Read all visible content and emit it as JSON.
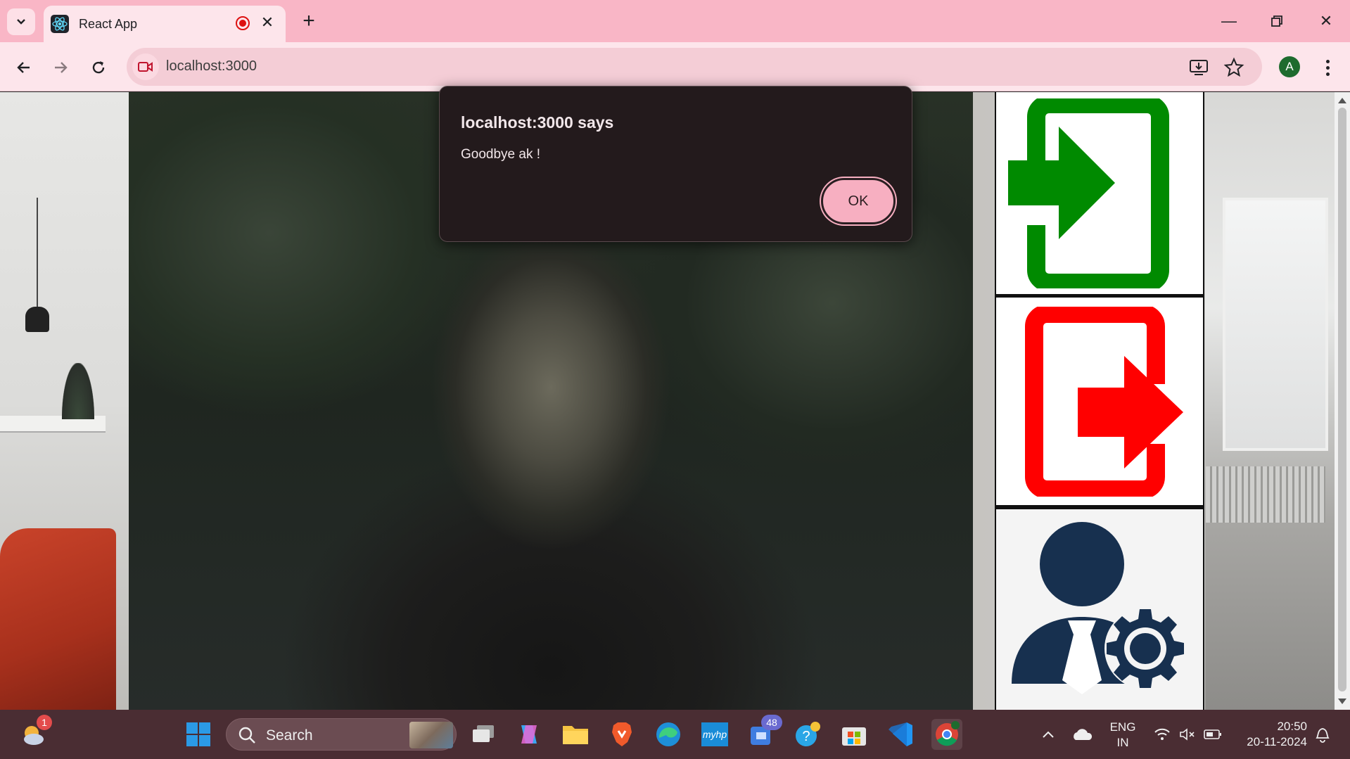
{
  "browser": {
    "tab_title": "React App",
    "url": "localhost:3000",
    "profile_initial": "A",
    "icons": [
      "tab-list-icon",
      "react-logo-icon",
      "recording-icon",
      "close-tab-icon",
      "new-tab-icon",
      "minimize-icon",
      "restore-icon",
      "close-window-icon",
      "back-icon",
      "forward-icon",
      "reload-icon",
      "camera-in-use-icon",
      "install-app-icon",
      "bookmark-star-icon",
      "chrome-menu-icon"
    ],
    "theme_color": "#f9b6c6"
  },
  "page": {
    "actions": [
      {
        "name": "check-in",
        "icon": "enter-door-icon",
        "color": "#008a00"
      },
      {
        "name": "check-out",
        "icon": "exit-door-icon",
        "color": "#ff0000"
      },
      {
        "name": "admin",
        "icon": "admin-user-gear-icon",
        "color": "#17304f"
      }
    ]
  },
  "alert": {
    "title": "localhost:3000 says",
    "message": "Goodbye ak !",
    "ok_label": "OK"
  },
  "taskbar": {
    "search_placeholder": "Search",
    "weather_badge": "1",
    "teams_badge": "48",
    "hp_label": "myhp",
    "language": "ENG",
    "region": "IN",
    "time": "20:50",
    "date": "20-11-2024"
  }
}
